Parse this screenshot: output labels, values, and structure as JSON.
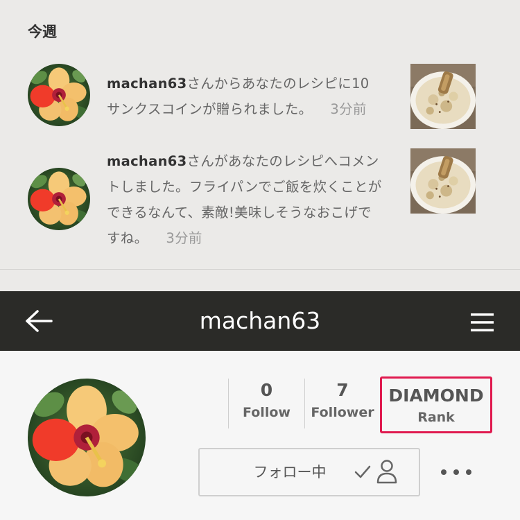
{
  "notifications": {
    "section_title": "今週",
    "items": [
      {
        "user": "machan63",
        "line1_rest": "さんからあなたのレシピに10",
        "line2": "サンクスコインが贈られました。",
        "time": "3分前",
        "avatar_icon": "hibiscus-flower-photo",
        "thumbnail_icon": "rice-dish-photo"
      },
      {
        "user": "machan63",
        "line1_rest": "さんがあなたのレシピへコメン",
        "line2": "トしました。フライパンでご飯を炊くことが",
        "line3": "できるなんて、素敵!美味しそうなおこげで",
        "line4": "すね。",
        "time": "3分前",
        "avatar_icon": "hibiscus-flower-photo",
        "thumbnail_icon": "rice-dish-photo"
      }
    ]
  },
  "header": {
    "title": "machan63",
    "back_icon": "arrow-left-icon",
    "menu_icon": "hamburger-menu-icon"
  },
  "profile": {
    "avatar_icon": "hibiscus-flower-photo",
    "stats": [
      {
        "value": "0",
        "label": "Follow"
      },
      {
        "value": "7",
        "label": "Follower"
      }
    ],
    "rank": {
      "value": "DIAMOND",
      "label": "Rank"
    },
    "follow_button": {
      "label": "フォロー中",
      "icons": [
        "check-icon",
        "user-icon"
      ]
    },
    "more_icon": "more-dots-icon"
  },
  "colors": {
    "header_bg": "#2b2b28",
    "rank_highlight": "#e01a4f",
    "notification_bg": "#ebeae8",
    "profile_bg": "#f6f6f6"
  }
}
